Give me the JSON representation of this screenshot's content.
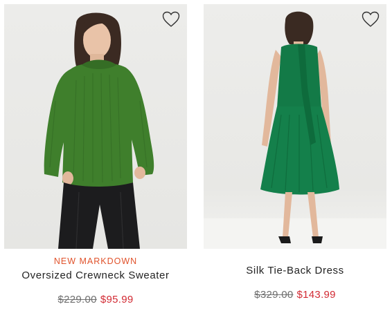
{
  "products": [
    {
      "badge": "NEW MARKDOWN",
      "name": "Oversized Crewneck Sweater",
      "original_price": "$229.00",
      "sale_price": "$95.99",
      "image_icon": "woman-green-sweater-image",
      "favorite_icon": "heart-outline-icon"
    },
    {
      "badge": "",
      "name": "Silk Tie-Back Dress",
      "original_price": "$329.00",
      "sale_price": "$143.99",
      "image_icon": "woman-green-dress-image",
      "favorite_icon": "heart-outline-icon"
    }
  ],
  "colors": {
    "badge": "#e0522b",
    "sale_price": "#d22a33",
    "original_price": "#6e6e6e",
    "text": "#222222",
    "product_green": "#3f7f2c",
    "dress_green": "#137a47"
  }
}
